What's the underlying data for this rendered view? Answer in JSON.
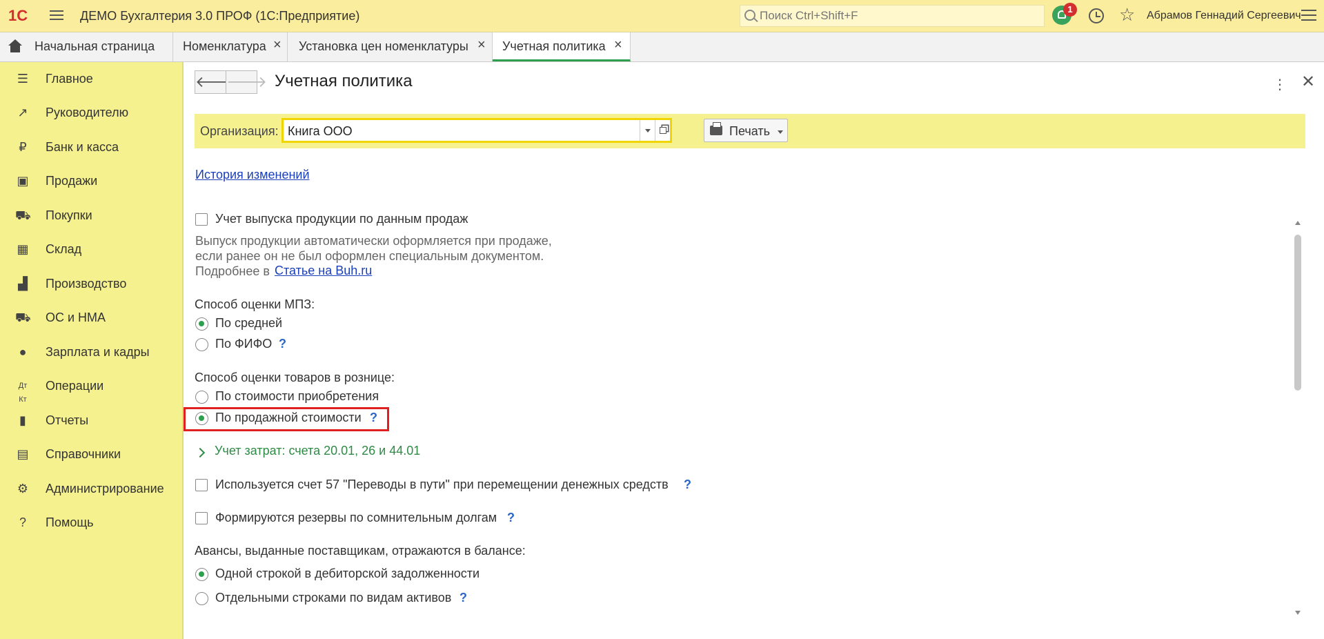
{
  "app": {
    "logo": "1С",
    "title": "ДЕМО Бухгалтерия 3.0 ПРОФ  (1С:Предприятие)",
    "search_placeholder": "Поиск Ctrl+Shift+F",
    "notifications_count": "1",
    "user": "Абрамов Геннадий Сергеевич"
  },
  "tabs": [
    {
      "label": "Начальная страница"
    },
    {
      "label": "Номенклатура",
      "close": "×"
    },
    {
      "label": "Установка цен номенклатуры",
      "close": "×"
    },
    {
      "label": "Учетная политика",
      "close": "×"
    }
  ],
  "sidebar": {
    "items": [
      {
        "label": "Главное",
        "icon": "menu-icon"
      },
      {
        "label": "Руководителю",
        "icon": "trend-icon"
      },
      {
        "label": "Банк и касса",
        "icon": "ruble-icon"
      },
      {
        "label": "Продажи",
        "icon": "bag-icon"
      },
      {
        "label": "Покупки",
        "icon": "cart-icon"
      },
      {
        "label": "Склад",
        "icon": "warehouse-icon"
      },
      {
        "label": "Производство",
        "icon": "factory-icon"
      },
      {
        "label": "ОС и НМА",
        "icon": "truck-icon"
      },
      {
        "label": "Зарплата и кадры",
        "icon": "person-icon"
      },
      {
        "label": "Операции",
        "icon": "dt-kt-icon"
      },
      {
        "label": "Отчеты",
        "icon": "bar-chart-icon"
      },
      {
        "label": "Справочники",
        "icon": "book-icon"
      },
      {
        "label": "Администрирование",
        "icon": "gear-icon"
      },
      {
        "label": "Помощь",
        "icon": "question-icon"
      }
    ]
  },
  "form": {
    "title": "Учетная политика",
    "org_label": "Организация:",
    "org_value": "Книга ООО",
    "print_label": "Печать",
    "history_link": "История изменений",
    "sales_output_checkbox": "Учет выпуска продукции по данным продаж",
    "sales_output_note_1": "Выпуск продукции автоматически оформляется при продаже,",
    "sales_output_note_2": "если ранее он не был оформлен специальным документом.",
    "more_prefix": "Подробнее в",
    "more_link": "Статье на Buh.ru",
    "mpz_header": "Способ оценки МПЗ:",
    "mpz_option_avg": "По средней",
    "mpz_option_fifo": "По ФИФО",
    "retail_header": "Способ оценки товаров в рознице:",
    "retail_option_cost": "По стоимости приобретения",
    "retail_option_sale": "По продажной стоимости",
    "costs_group": "Учет затрат: счета 20.01, 26 и 44.01",
    "account57_checkbox": "Используется счет 57 \"Переводы в пути\" при перемещении денежных средств",
    "reserves_checkbox": "Формируются резервы по сомнительным долгам",
    "advances_header": "Авансы, выданные поставщикам, отражаются в балансе:",
    "advances_option_single": "Одной строкой в дебиторской задолженности",
    "advances_option_separate": "Отдельными строками по видам активов",
    "help_mark": "?",
    "mpz_selected": "По средней",
    "retail_selected": "По продажной стоимости",
    "advances_selected": "Одной строкой в дебиторской задолженности"
  },
  "colors": {
    "accent_green": "#2e9e4f",
    "panel_yellow": "#f5f18f",
    "highlight_red": "#e02020"
  }
}
